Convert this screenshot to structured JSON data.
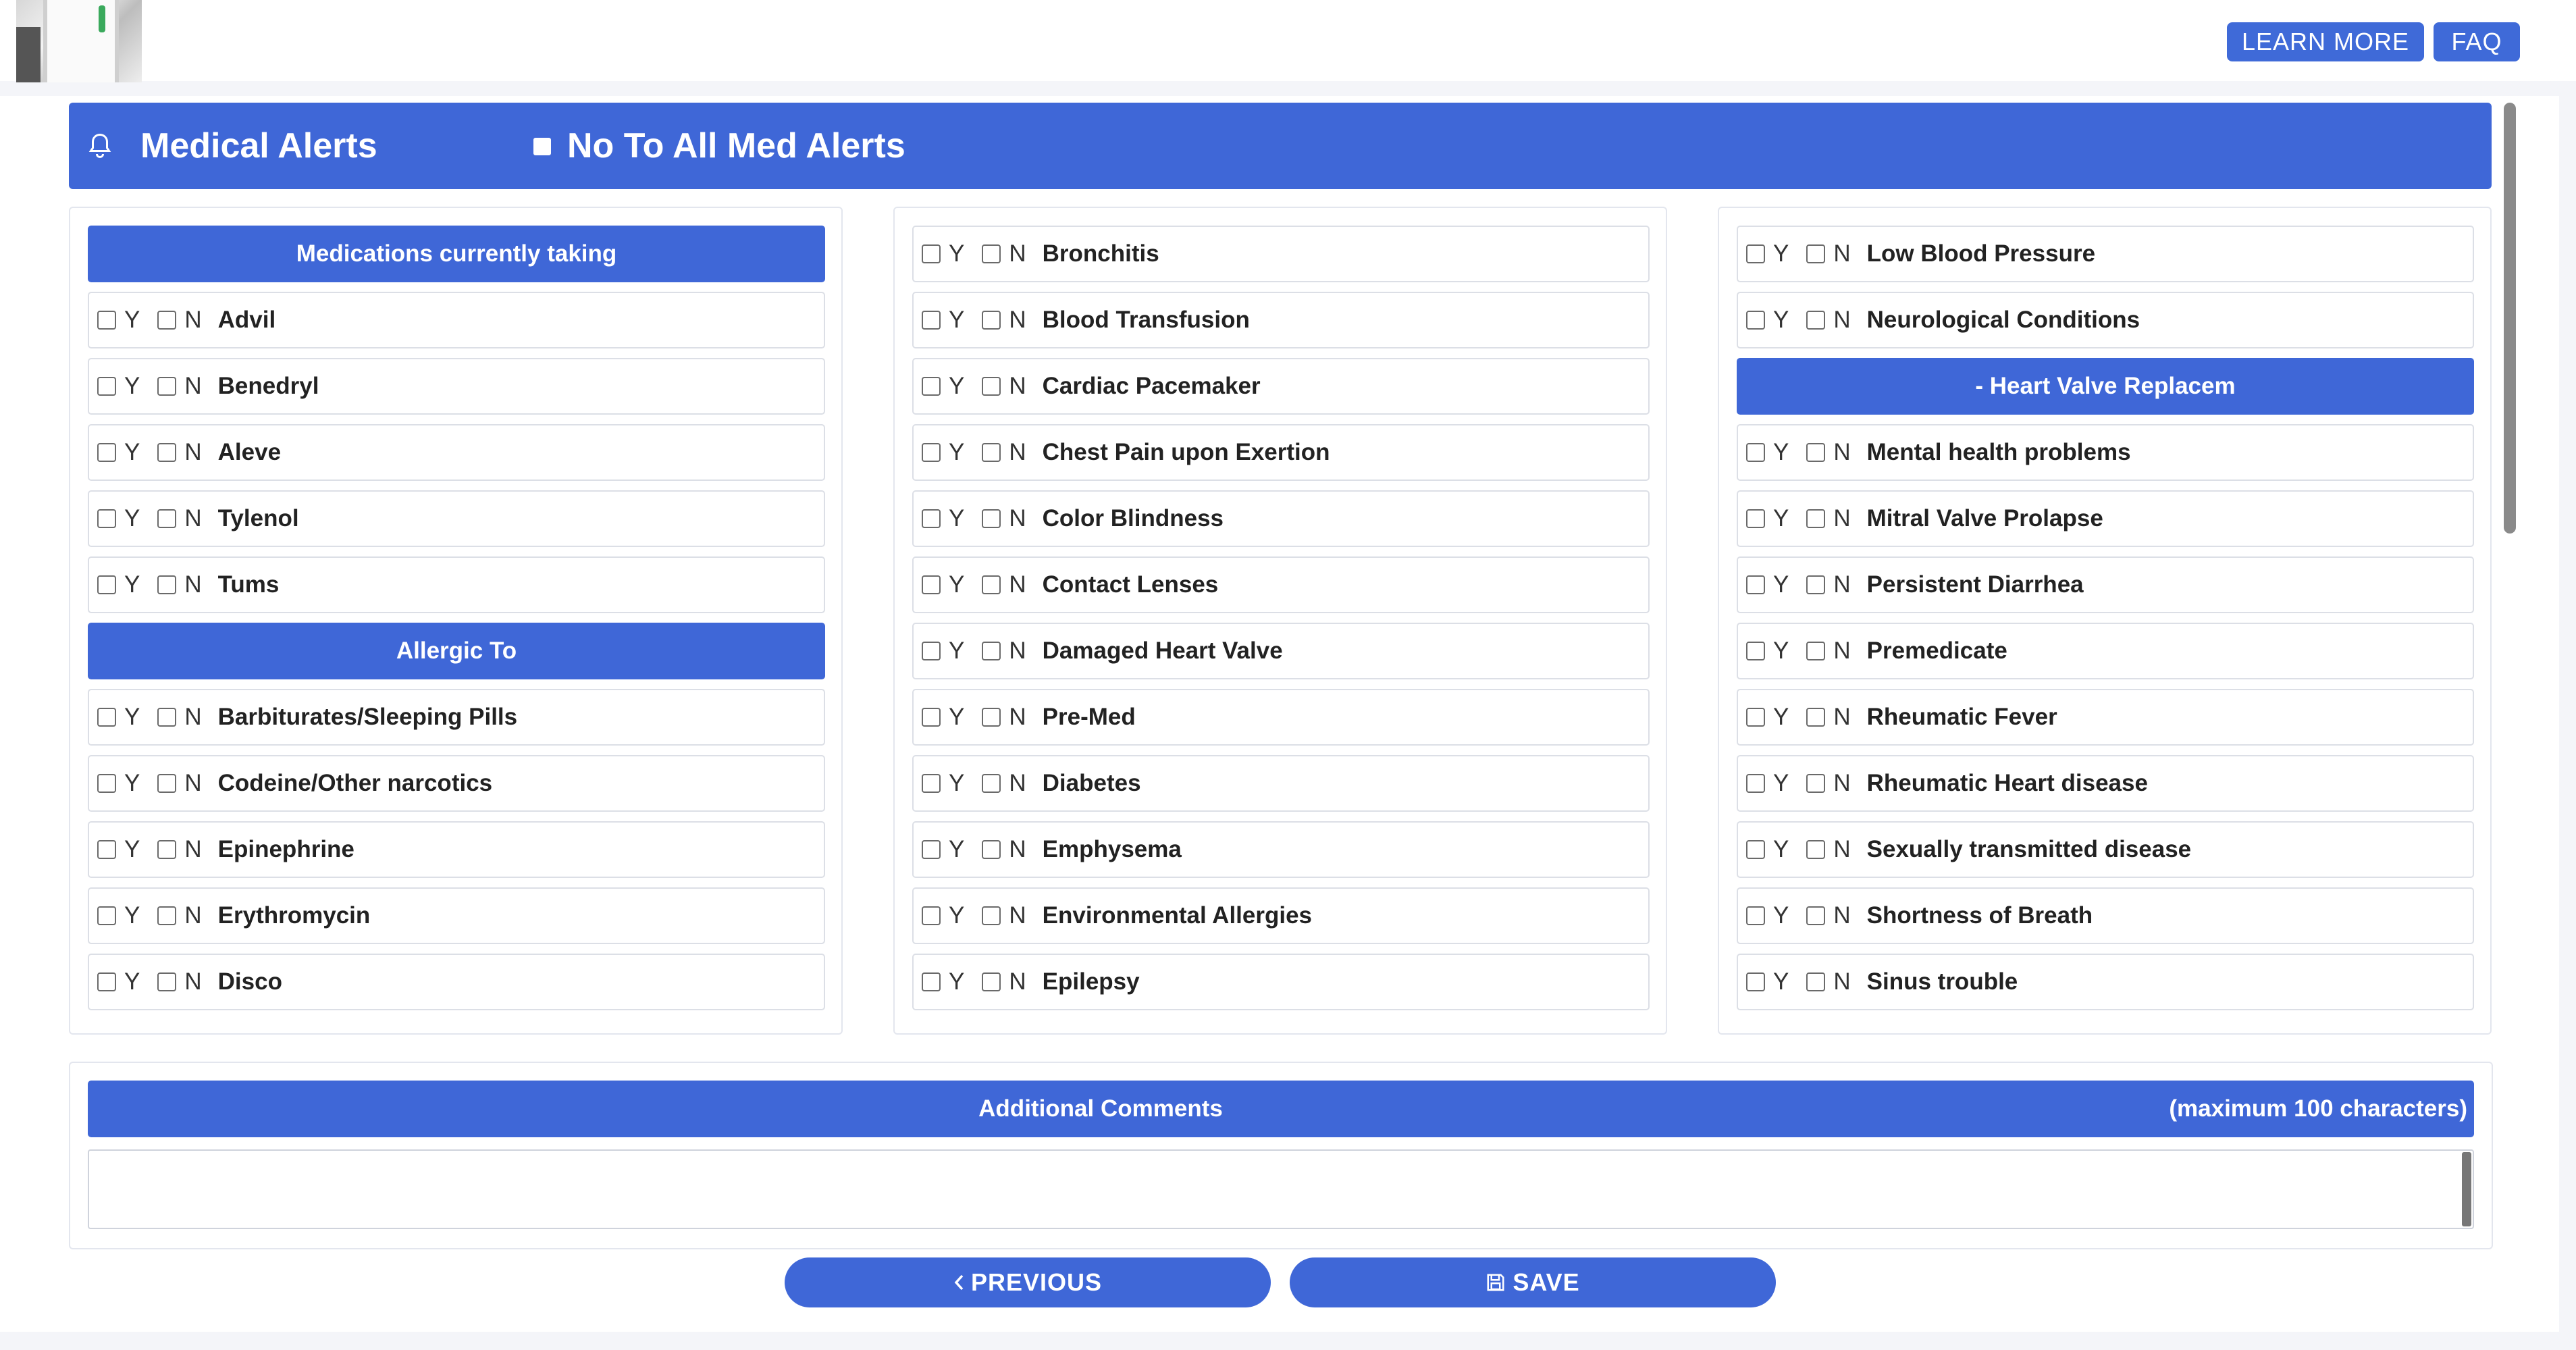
{
  "header": {
    "learn_more_label": "LEARN MORE",
    "faq_label": "FAQ",
    "logo_icon": "doctor-photo"
  },
  "alerts_bar": {
    "icon": "bell-icon",
    "title": "Medical Alerts",
    "no_to_all_label": "No To All Med Alerts"
  },
  "options": {
    "yes": "Y",
    "no": "N"
  },
  "columns": [
    {
      "rows": [
        {
          "type": "header",
          "label": "Medications currently taking"
        },
        {
          "type": "item",
          "label": "Advil"
        },
        {
          "type": "item",
          "label": "Benedryl"
        },
        {
          "type": "item",
          "label": "Aleve"
        },
        {
          "type": "item",
          "label": "Tylenol"
        },
        {
          "type": "item",
          "label": "Tums"
        },
        {
          "type": "header",
          "label": "Allergic To"
        },
        {
          "type": "item",
          "label": "Barbiturates/Sleeping Pills"
        },
        {
          "type": "item",
          "label": "Codeine/Other narcotics"
        },
        {
          "type": "item",
          "label": "Epinephrine"
        },
        {
          "type": "item",
          "label": "Erythromycin"
        },
        {
          "type": "item",
          "label": "Disco"
        }
      ]
    },
    {
      "rows": [
        {
          "type": "item",
          "label": "Bronchitis"
        },
        {
          "type": "item",
          "label": "Blood Transfusion"
        },
        {
          "type": "item",
          "label": "Cardiac Pacemaker"
        },
        {
          "type": "item",
          "label": "Chest Pain upon Exertion"
        },
        {
          "type": "item",
          "label": "Color Blindness"
        },
        {
          "type": "item",
          "label": "Contact Lenses"
        },
        {
          "type": "item",
          "label": "Damaged Heart Valve"
        },
        {
          "type": "item",
          "label": "Pre-Med"
        },
        {
          "type": "item",
          "label": "Diabetes"
        },
        {
          "type": "item",
          "label": "Emphysema"
        },
        {
          "type": "item",
          "label": "Environmental Allergies"
        },
        {
          "type": "item",
          "label": "Epilepsy"
        }
      ]
    },
    {
      "rows": [
        {
          "type": "item",
          "label": "Low Blood Pressure"
        },
        {
          "type": "item",
          "label": "Neurological Conditions"
        },
        {
          "type": "header",
          "label": "- Heart Valve Replacem"
        },
        {
          "type": "item",
          "label": "Mental health problems"
        },
        {
          "type": "item",
          "label": "Mitral Valve Prolapse"
        },
        {
          "type": "item",
          "label": "Persistent Diarrhea"
        },
        {
          "type": "item",
          "label": "Premedicate"
        },
        {
          "type": "item",
          "label": "Rheumatic Fever"
        },
        {
          "type": "item",
          "label": "Rheumatic Heart disease"
        },
        {
          "type": "item",
          "label": "Sexually transmitted disease"
        },
        {
          "type": "item",
          "label": "Shortness of Breath"
        },
        {
          "type": "item",
          "label": "Sinus trouble"
        }
      ]
    }
  ],
  "comments": {
    "title": "Additional Comments",
    "max_note": "(maximum 100 characters)",
    "value": ""
  },
  "nav": {
    "previous_label": "PREVIOUS",
    "previous_icon": "chevron-left-icon",
    "save_label": "SAVE",
    "save_icon": "floppy-disk-icon"
  },
  "colors": {
    "accent": "#3f67d7",
    "page_bg": "#f4f5f9"
  }
}
